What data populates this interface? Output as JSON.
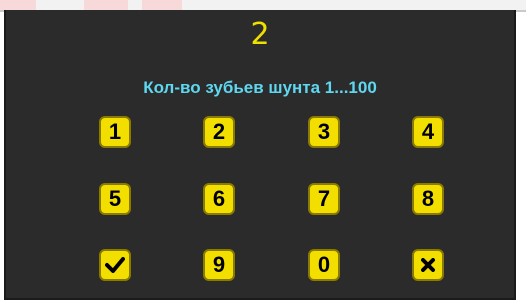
{
  "dialog": {
    "entered_value": "2",
    "prompt": "Кол-во зубьев шунта 1...100"
  },
  "keypad": {
    "keys": [
      {
        "label": "1"
      },
      {
        "label": "2"
      },
      {
        "label": "3"
      },
      {
        "label": "4"
      },
      {
        "label": "5"
      },
      {
        "label": "6"
      },
      {
        "label": "7"
      },
      {
        "label": "8"
      },
      {
        "icon": "check-icon"
      },
      {
        "label": "9"
      },
      {
        "label": "0"
      },
      {
        "icon": "close-icon"
      }
    ]
  },
  "colors": {
    "background": "#2b2b2b",
    "value_text": "#f0e000",
    "prompt_text": "#5fd7f0",
    "key_fill": "#f2df00",
    "key_text": "#000000"
  }
}
